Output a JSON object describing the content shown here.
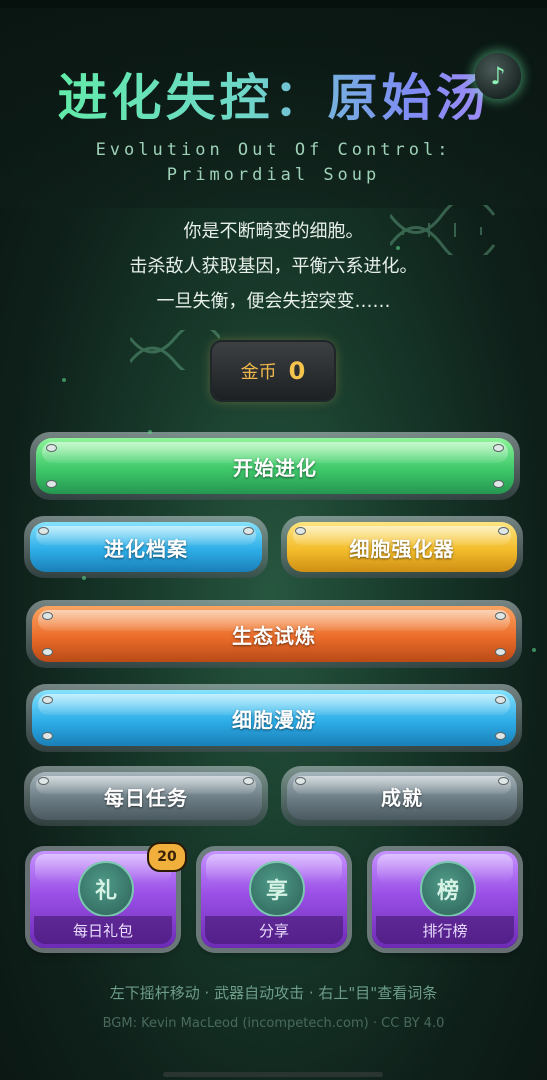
{
  "title": "进化失控：原始汤",
  "subtitle": "Evolution Out Of Control: Primordial Soup",
  "music_icon": "music-note-icon",
  "music_glyph": "♪",
  "intro": [
    "你是不断畸变的细胞。",
    "击杀敌人获取基因，平衡六系进化。",
    "一旦失衡，便会失控突变……"
  ],
  "coins": {
    "label": "金币",
    "value": "0"
  },
  "buttons": {
    "start": "开始进化",
    "archive": "进化档案",
    "enhancer": "细胞强化器",
    "trial": "生态试炼",
    "roam": "细胞漫游",
    "daily_tasks": "每日任务",
    "achievements": "成就"
  },
  "cards": [
    {
      "icon": "礼",
      "label": "每日礼包"
    },
    {
      "icon": "享",
      "label": "分享"
    },
    {
      "icon": "榜",
      "label": "排行榜"
    }
  ],
  "badge": "20",
  "hint": "左下摇杆移动 · 武器自动攻击 · 右上\"目\"查看词条",
  "credit": "BGM: Kevin MacLeod (incompetech.com) · CC BY 4.0",
  "colors": {
    "background": "#183a2b",
    "start": "#3fc96b",
    "archive": "#2eaee8",
    "enhancer": "#f3bd2c",
    "trial": "#ec6d2a",
    "roam": "#2eaee8",
    "secondary": "#6c7d85",
    "card": "#9a4fe6",
    "coin": "#f5c44d"
  }
}
